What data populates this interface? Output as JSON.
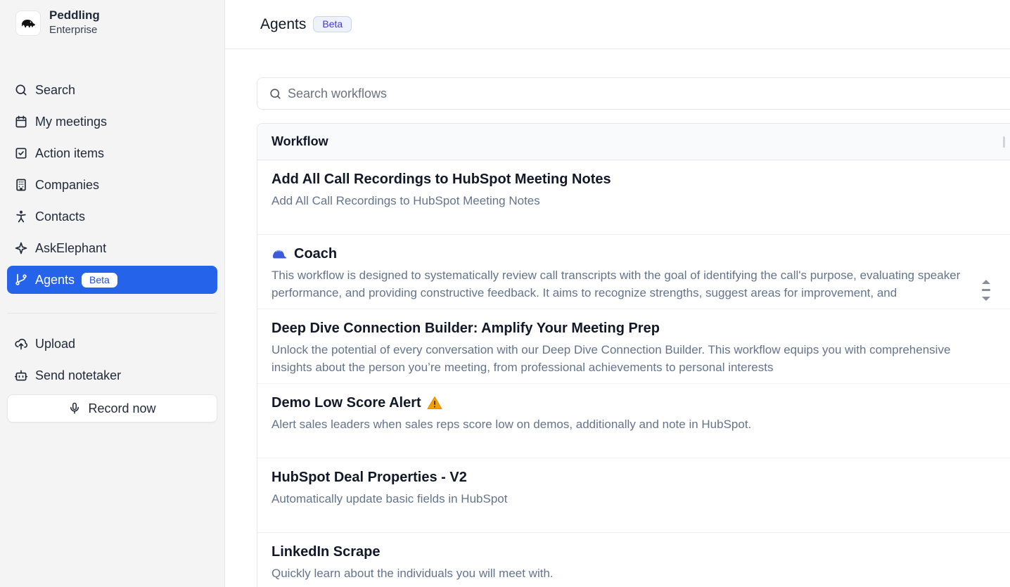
{
  "org": {
    "name": "Peddling",
    "plan": "Enterprise",
    "logo_icon": "elephant-icon"
  },
  "sidebar": {
    "items": [
      {
        "label": "Search",
        "icon": "search-icon"
      },
      {
        "label": "My meetings",
        "icon": "calendar-icon"
      },
      {
        "label": "Action items",
        "icon": "checkbox-icon"
      },
      {
        "label": "Companies",
        "icon": "building-icon"
      },
      {
        "label": "Contacts",
        "icon": "person-icon"
      },
      {
        "label": "AskElephant",
        "icon": "sparkle-icon"
      },
      {
        "label": "Agents",
        "icon": "git-branch-icon",
        "badge": "Beta",
        "active": true
      }
    ],
    "secondary": [
      {
        "label": "Upload",
        "icon": "cloud-upload-icon"
      },
      {
        "label": "Send notetaker",
        "icon": "bot-icon"
      }
    ],
    "record_button": {
      "label": "Record now",
      "icon": "microphone-icon"
    }
  },
  "header": {
    "title": "Agents",
    "badge": "Beta"
  },
  "search": {
    "placeholder": "Search workflows",
    "value": ""
  },
  "table": {
    "column_header": "Workflow",
    "rows": [
      {
        "title": "Add All Call Recordings to HubSpot Meeting Notes",
        "description": "Add All Call Recordings to HubSpot Meeting Notes"
      },
      {
        "title": "Coach",
        "title_prefix_icon": "blue-cap-icon",
        "description": "This workflow is designed to systematically review call transcripts with the goal of identifying the call's purpose, evaluating speaker performance, and providing constructive feedback. It aims to recognize strengths, suggest areas for improvement, and"
      },
      {
        "title": "Deep Dive Connection Builder: Amplify Your Meeting Prep",
        "description": "Unlock the potential of every conversation with our Deep Dive Connection Builder. This workflow equips you with comprehensive insights about the person you’re meeting, from professional achievements to personal interests"
      },
      {
        "title": "Demo Low Score Alert",
        "title_suffix_icon": "warning-icon",
        "description": "Alert sales leaders when sales reps score low on demos, additionally and note in HubSpot."
      },
      {
        "title": "HubSpot Deal Properties - V2",
        "description": "Automatically update basic fields in HubSpot"
      },
      {
        "title": "LinkedIn Scrape",
        "description": "Quickly learn about the individuals you will meet with."
      }
    ]
  },
  "colors": {
    "accent": "#2563eb",
    "sidebar_bg": "#f4f4f5",
    "description_text": "#64748b",
    "badge_bg": "#eef2ff",
    "badge_text": "#4338ca"
  }
}
